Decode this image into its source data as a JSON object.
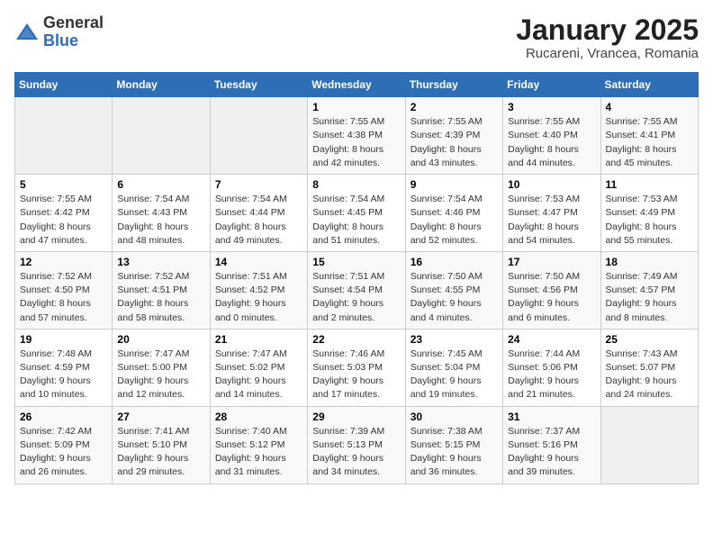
{
  "header": {
    "logo_general": "General",
    "logo_blue": "Blue",
    "title": "January 2025",
    "subtitle": "Rucareni, Vrancea, Romania"
  },
  "weekdays": [
    "Sunday",
    "Monday",
    "Tuesday",
    "Wednesday",
    "Thursday",
    "Friday",
    "Saturday"
  ],
  "weeks": [
    [
      {
        "day": "",
        "info": ""
      },
      {
        "day": "",
        "info": ""
      },
      {
        "day": "",
        "info": ""
      },
      {
        "day": "1",
        "info": "Sunrise: 7:55 AM\nSunset: 4:38 PM\nDaylight: 8 hours\nand 42 minutes."
      },
      {
        "day": "2",
        "info": "Sunrise: 7:55 AM\nSunset: 4:39 PM\nDaylight: 8 hours\nand 43 minutes."
      },
      {
        "day": "3",
        "info": "Sunrise: 7:55 AM\nSunset: 4:40 PM\nDaylight: 8 hours\nand 44 minutes."
      },
      {
        "day": "4",
        "info": "Sunrise: 7:55 AM\nSunset: 4:41 PM\nDaylight: 8 hours\nand 45 minutes."
      }
    ],
    [
      {
        "day": "5",
        "info": "Sunrise: 7:55 AM\nSunset: 4:42 PM\nDaylight: 8 hours\nand 47 minutes."
      },
      {
        "day": "6",
        "info": "Sunrise: 7:54 AM\nSunset: 4:43 PM\nDaylight: 8 hours\nand 48 minutes."
      },
      {
        "day": "7",
        "info": "Sunrise: 7:54 AM\nSunset: 4:44 PM\nDaylight: 8 hours\nand 49 minutes."
      },
      {
        "day": "8",
        "info": "Sunrise: 7:54 AM\nSunset: 4:45 PM\nDaylight: 8 hours\nand 51 minutes."
      },
      {
        "day": "9",
        "info": "Sunrise: 7:54 AM\nSunset: 4:46 PM\nDaylight: 8 hours\nand 52 minutes."
      },
      {
        "day": "10",
        "info": "Sunrise: 7:53 AM\nSunset: 4:47 PM\nDaylight: 8 hours\nand 54 minutes."
      },
      {
        "day": "11",
        "info": "Sunrise: 7:53 AM\nSunset: 4:49 PM\nDaylight: 8 hours\nand 55 minutes."
      }
    ],
    [
      {
        "day": "12",
        "info": "Sunrise: 7:52 AM\nSunset: 4:50 PM\nDaylight: 8 hours\nand 57 minutes."
      },
      {
        "day": "13",
        "info": "Sunrise: 7:52 AM\nSunset: 4:51 PM\nDaylight: 8 hours\nand 58 minutes."
      },
      {
        "day": "14",
        "info": "Sunrise: 7:51 AM\nSunset: 4:52 PM\nDaylight: 9 hours\nand 0 minutes."
      },
      {
        "day": "15",
        "info": "Sunrise: 7:51 AM\nSunset: 4:54 PM\nDaylight: 9 hours\nand 2 minutes."
      },
      {
        "day": "16",
        "info": "Sunrise: 7:50 AM\nSunset: 4:55 PM\nDaylight: 9 hours\nand 4 minutes."
      },
      {
        "day": "17",
        "info": "Sunrise: 7:50 AM\nSunset: 4:56 PM\nDaylight: 9 hours\nand 6 minutes."
      },
      {
        "day": "18",
        "info": "Sunrise: 7:49 AM\nSunset: 4:57 PM\nDaylight: 9 hours\nand 8 minutes."
      }
    ],
    [
      {
        "day": "19",
        "info": "Sunrise: 7:48 AM\nSunset: 4:59 PM\nDaylight: 9 hours\nand 10 minutes."
      },
      {
        "day": "20",
        "info": "Sunrise: 7:47 AM\nSunset: 5:00 PM\nDaylight: 9 hours\nand 12 minutes."
      },
      {
        "day": "21",
        "info": "Sunrise: 7:47 AM\nSunset: 5:02 PM\nDaylight: 9 hours\nand 14 minutes."
      },
      {
        "day": "22",
        "info": "Sunrise: 7:46 AM\nSunset: 5:03 PM\nDaylight: 9 hours\nand 17 minutes."
      },
      {
        "day": "23",
        "info": "Sunrise: 7:45 AM\nSunset: 5:04 PM\nDaylight: 9 hours\nand 19 minutes."
      },
      {
        "day": "24",
        "info": "Sunrise: 7:44 AM\nSunset: 5:06 PM\nDaylight: 9 hours\nand 21 minutes."
      },
      {
        "day": "25",
        "info": "Sunrise: 7:43 AM\nSunset: 5:07 PM\nDaylight: 9 hours\nand 24 minutes."
      }
    ],
    [
      {
        "day": "26",
        "info": "Sunrise: 7:42 AM\nSunset: 5:09 PM\nDaylight: 9 hours\nand 26 minutes."
      },
      {
        "day": "27",
        "info": "Sunrise: 7:41 AM\nSunset: 5:10 PM\nDaylight: 9 hours\nand 29 minutes."
      },
      {
        "day": "28",
        "info": "Sunrise: 7:40 AM\nSunset: 5:12 PM\nDaylight: 9 hours\nand 31 minutes."
      },
      {
        "day": "29",
        "info": "Sunrise: 7:39 AM\nSunset: 5:13 PM\nDaylight: 9 hours\nand 34 minutes."
      },
      {
        "day": "30",
        "info": "Sunrise: 7:38 AM\nSunset: 5:15 PM\nDaylight: 9 hours\nand 36 minutes."
      },
      {
        "day": "31",
        "info": "Sunrise: 7:37 AM\nSunset: 5:16 PM\nDaylight: 9 hours\nand 39 minutes."
      },
      {
        "day": "",
        "info": ""
      }
    ]
  ]
}
